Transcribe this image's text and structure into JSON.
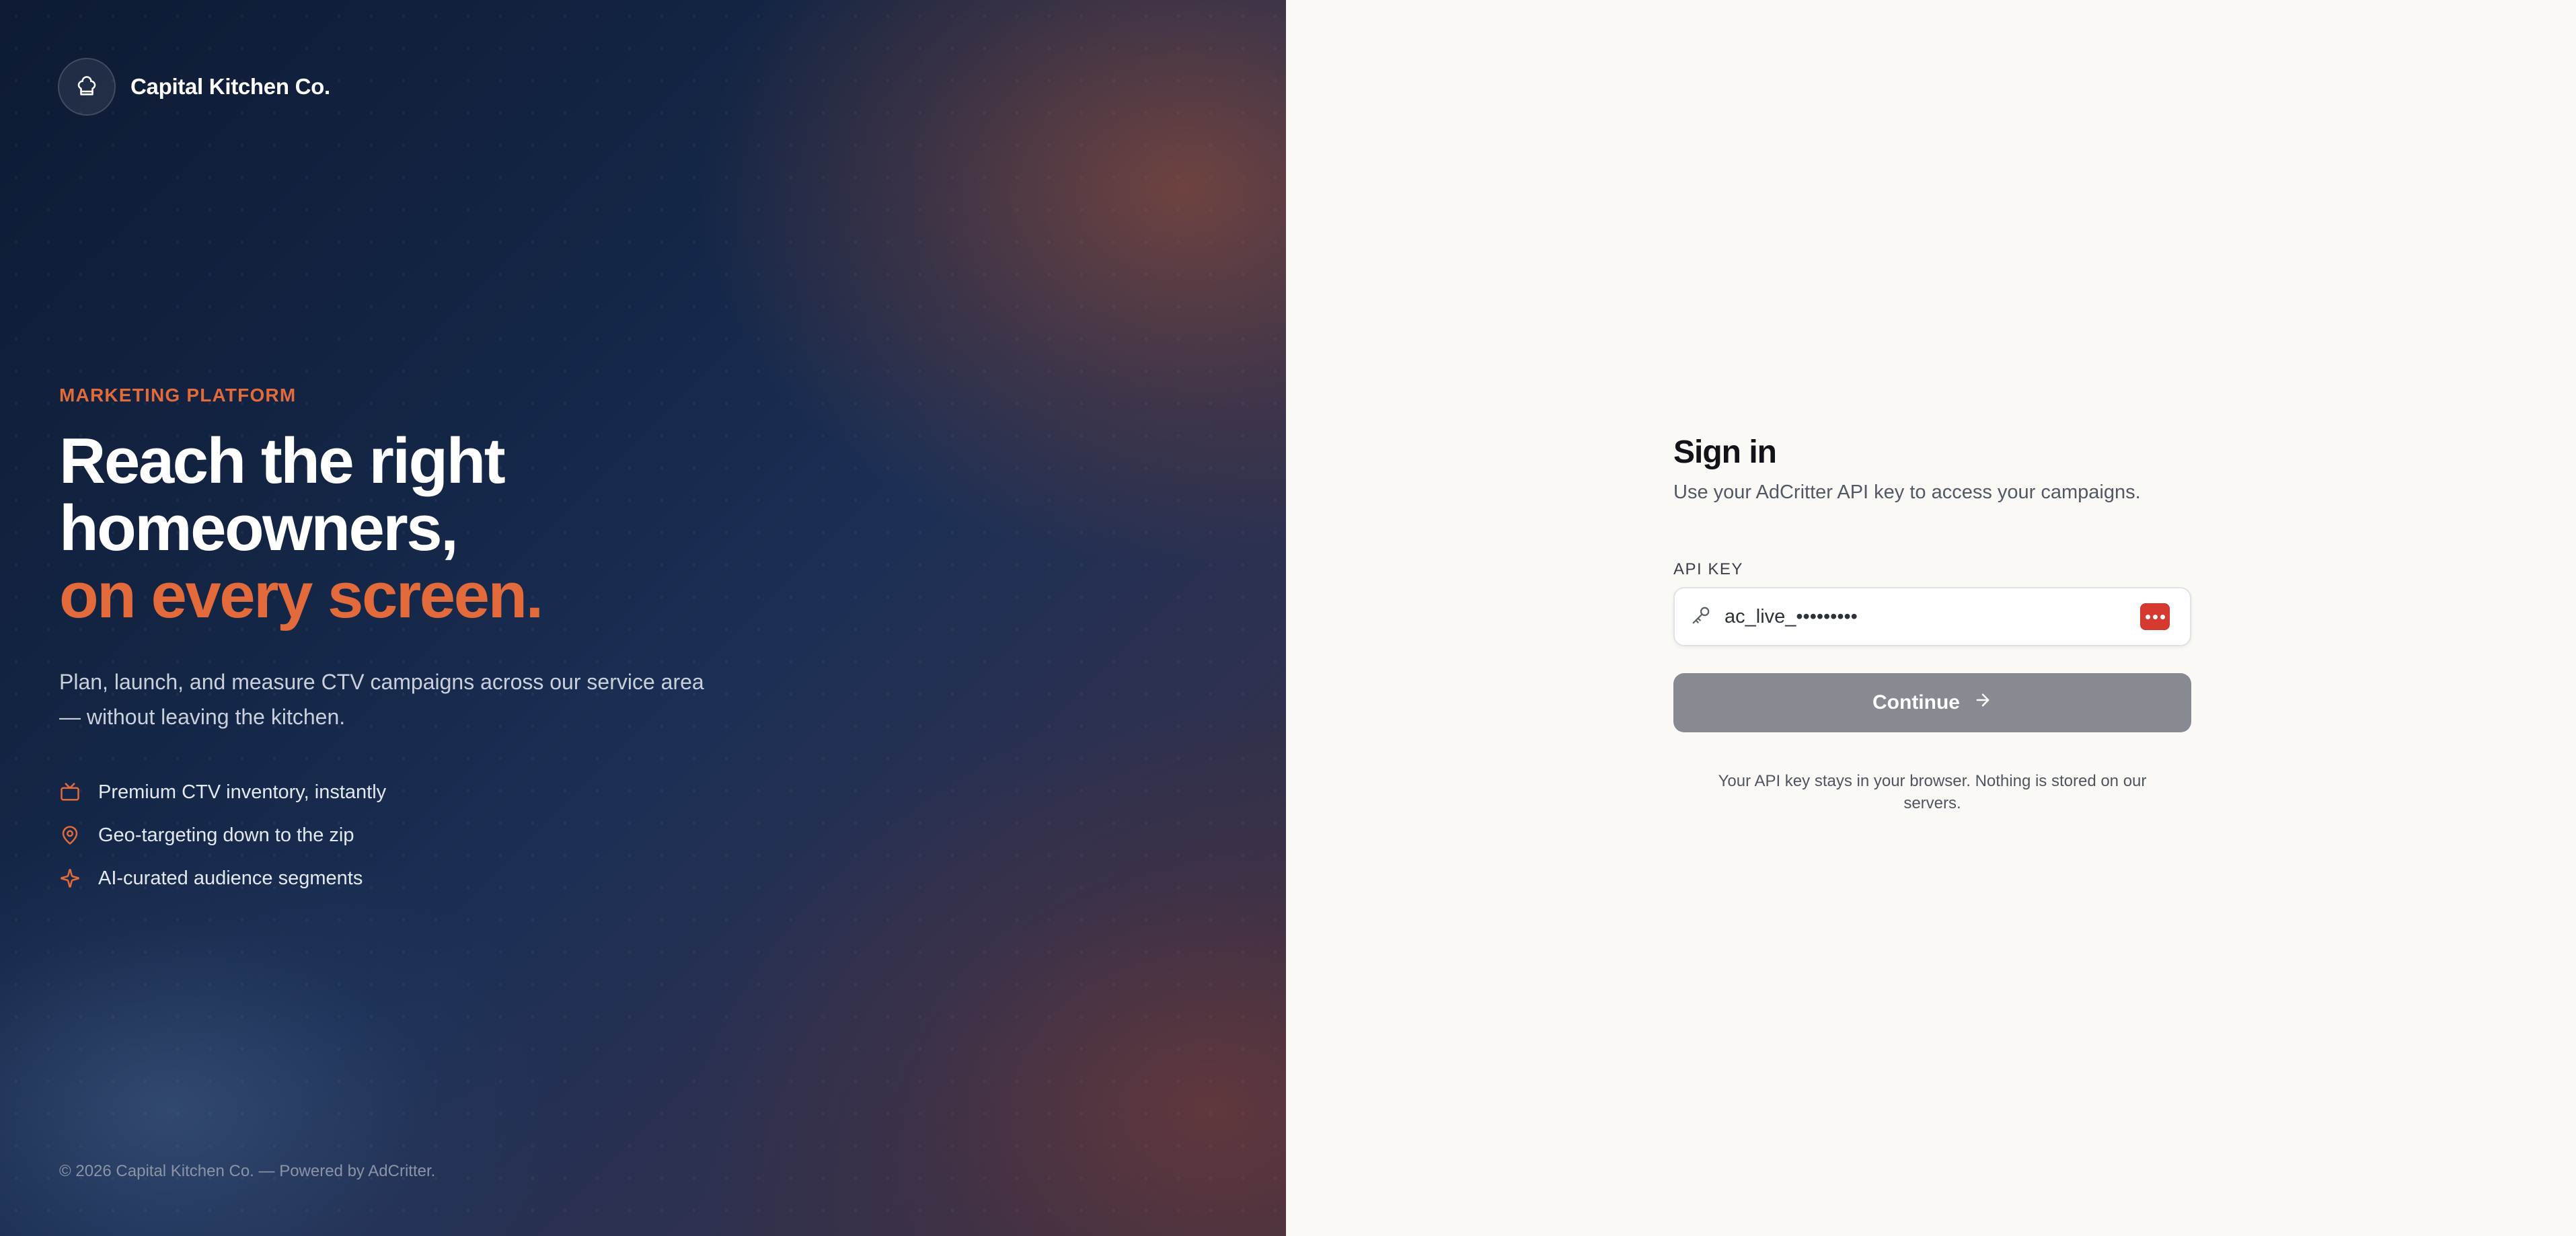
{
  "brand": {
    "name": "Capital Kitchen Co.",
    "logo_icon": "chef-hat-icon"
  },
  "hero": {
    "eyebrow": "MARKETING PLATFORM",
    "headline_line1": "Reach the right",
    "headline_line2": "homeowners,",
    "headline_accent": "on every screen.",
    "lede": "Plan, launch, and measure CTV campaigns across our service area — without leaving the kitchen.",
    "features": [
      {
        "icon": "tv-icon",
        "label": "Premium CTV inventory, instantly"
      },
      {
        "icon": "map-pin-icon",
        "label": "Geo-targeting down to the zip"
      },
      {
        "icon": "sparkles-icon",
        "label": "AI-curated audience segments"
      }
    ],
    "footer": "© 2026 Capital Kitchen Co. — Powered by AdCritter."
  },
  "signin": {
    "title": "Sign in",
    "subtitle": "Use your AdCritter API key to access your campaigns.",
    "api_key_label": "API KEY",
    "api_key_value": "ac_live_•••••••••",
    "continue_label": "Continue",
    "privacy_note": "Your API key stays in your browser. Nothing is stored on our servers."
  },
  "colors": {
    "accent": "#e26a3b",
    "button_disabled": "#878a90",
    "password_manager": "#d6392f",
    "panel_bg": "#faf9f6"
  }
}
